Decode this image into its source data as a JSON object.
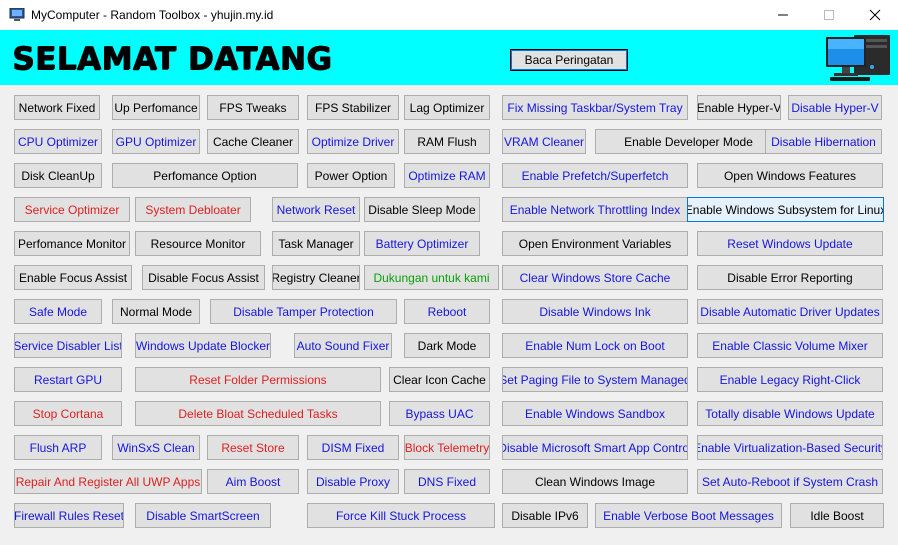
{
  "window": {
    "title": "MyComputer - Random Toolbox - yhujin.my.id",
    "controls": [
      "minimize-icon",
      "maximize-icon",
      "close-icon"
    ]
  },
  "header": {
    "welcome": "SELAMAT DATANG",
    "warning_button": "Baca Peringatan",
    "background": "#00ffff",
    "image": "computer-icon"
  },
  "colors": {
    "blue": "#1515e0",
    "red": "#e02020",
    "green": "#0aa00a",
    "black": "#000000",
    "button_bg": "#e1e1e1"
  },
  "buttons": [
    {
      "label": "Network Fixed",
      "color": "black"
    },
    {
      "label": "Up Perfomance",
      "color": "black"
    },
    {
      "label": "FPS Tweaks",
      "color": "black"
    },
    {
      "label": "FPS Stabilizer",
      "color": "black"
    },
    {
      "label": "Lag Optimizer",
      "color": "black"
    },
    {
      "label": "Fix Missing Taskbar/System Tray",
      "color": "blue"
    },
    {
      "label": "Enable Hyper-V",
      "color": "black"
    },
    {
      "label": "Disable Hyper-V",
      "color": "blue"
    },
    {
      "label": "CPU Optimizer",
      "color": "blue"
    },
    {
      "label": "GPU Optimizer",
      "color": "blue"
    },
    {
      "label": "Cache Cleaner",
      "color": "black"
    },
    {
      "label": "Optimize Driver",
      "color": "blue"
    },
    {
      "label": "RAM Flush",
      "color": "black"
    },
    {
      "label": "VRAM Cleaner",
      "color": "blue"
    },
    {
      "label": "Enable Developer Mode",
      "color": "black"
    },
    {
      "label": "Disable Hibernation",
      "color": "blue"
    },
    {
      "label": "Disk CleanUp",
      "color": "black"
    },
    {
      "label": "Perfomance Option",
      "color": "black"
    },
    {
      "label": "Power Option",
      "color": "black"
    },
    {
      "label": "Optimize RAM",
      "color": "blue"
    },
    {
      "label": "Enable Prefetch/Superfetch",
      "color": "blue"
    },
    {
      "label": "Open Windows Features",
      "color": "black"
    },
    {
      "label": "Service Optimizer",
      "color": "red"
    },
    {
      "label": "System Debloater",
      "color": "red"
    },
    {
      "label": "Network Reset",
      "color": "blue"
    },
    {
      "label": "Disable Sleep Mode",
      "color": "black"
    },
    {
      "label": "Enable Network Throttling Index",
      "color": "blue"
    },
    {
      "label": "Enable Windows Subsystem for Linux",
      "color": "black"
    },
    {
      "label": "Perfomance Monitor",
      "color": "black"
    },
    {
      "label": "Resource Monitor",
      "color": "black"
    },
    {
      "label": "Task Manager",
      "color": "black"
    },
    {
      "label": "Battery Optimizer",
      "color": "blue"
    },
    {
      "label": "Open Environment Variables",
      "color": "black"
    },
    {
      "label": "Reset Windows Update",
      "color": "blue"
    },
    {
      "label": "Enable Focus Assist",
      "color": "black"
    },
    {
      "label": "Disable Focus Assist",
      "color": "black"
    },
    {
      "label": "Registry Cleaner",
      "color": "black"
    },
    {
      "label": "Dukungan untuk kami",
      "color": "green"
    },
    {
      "label": "Clear Windows Store Cache",
      "color": "blue"
    },
    {
      "label": "Disable Error Reporting",
      "color": "black"
    },
    {
      "label": "Safe Mode",
      "color": "blue"
    },
    {
      "label": "Normal Mode",
      "color": "black"
    },
    {
      "label": "Disable Tamper Protection",
      "color": "blue"
    },
    {
      "label": "Reboot",
      "color": "blue"
    },
    {
      "label": "Disable Windows Ink",
      "color": "blue"
    },
    {
      "label": "Disable Automatic Driver Updates",
      "color": "blue"
    },
    {
      "label": "Service Disabler List",
      "color": "blue"
    },
    {
      "label": "Windows Update Blocker",
      "color": "blue"
    },
    {
      "label": "Auto Sound Fixer",
      "color": "blue"
    },
    {
      "label": "Dark Mode",
      "color": "black"
    },
    {
      "label": "Enable Num Lock on Boot",
      "color": "blue"
    },
    {
      "label": "Enable Classic Volume Mixer",
      "color": "blue"
    },
    {
      "label": "Restart GPU",
      "color": "blue"
    },
    {
      "label": "Reset Folder Permissions",
      "color": "red"
    },
    {
      "label": "Clear Icon Cache",
      "color": "black"
    },
    {
      "label": "Set Paging File to System Managed",
      "color": "blue"
    },
    {
      "label": "Enable Legacy Right-Click",
      "color": "blue"
    },
    {
      "label": "Stop Cortana",
      "color": "red"
    },
    {
      "label": "Delete Bloat Scheduled Tasks",
      "color": "red"
    },
    {
      "label": "Bypass UAC",
      "color": "blue"
    },
    {
      "label": "Enable Windows Sandbox",
      "color": "blue"
    },
    {
      "label": "Totally disable Windows Update",
      "color": "blue"
    },
    {
      "label": "Flush ARP",
      "color": "blue"
    },
    {
      "label": "WinSxS Clean",
      "color": "blue"
    },
    {
      "label": "Reset Store",
      "color": "red"
    },
    {
      "label": "DISM Fixed",
      "color": "blue"
    },
    {
      "label": "Block Telemetry",
      "color": "red"
    },
    {
      "label": "Disable Microsoft Smart App Control",
      "color": "blue"
    },
    {
      "label": "Enable Virtualization-Based Security",
      "color": "blue"
    },
    {
      "label": "Repair And Register All UWP Apps",
      "color": "red"
    },
    {
      "label": "Aim Boost",
      "color": "blue"
    },
    {
      "label": "Disable Proxy",
      "color": "blue"
    },
    {
      "label": "DNS Fixed",
      "color": "blue"
    },
    {
      "label": "Clean Windows Image",
      "color": "black"
    },
    {
      "label": "Set Auto-Reboot if System Crash",
      "color": "blue"
    },
    {
      "label": "Firewall Rules Reset",
      "color": "blue"
    },
    {
      "label": "Disable SmartScreen",
      "color": "blue"
    },
    {
      "label": "Force Kill Stuck Process",
      "color": "blue"
    },
    {
      "label": "Disable IPv6",
      "color": "black"
    },
    {
      "label": "Enable Verbose Boot Messages",
      "color": "blue"
    },
    {
      "label": "Idle Boost",
      "color": "black"
    }
  ]
}
